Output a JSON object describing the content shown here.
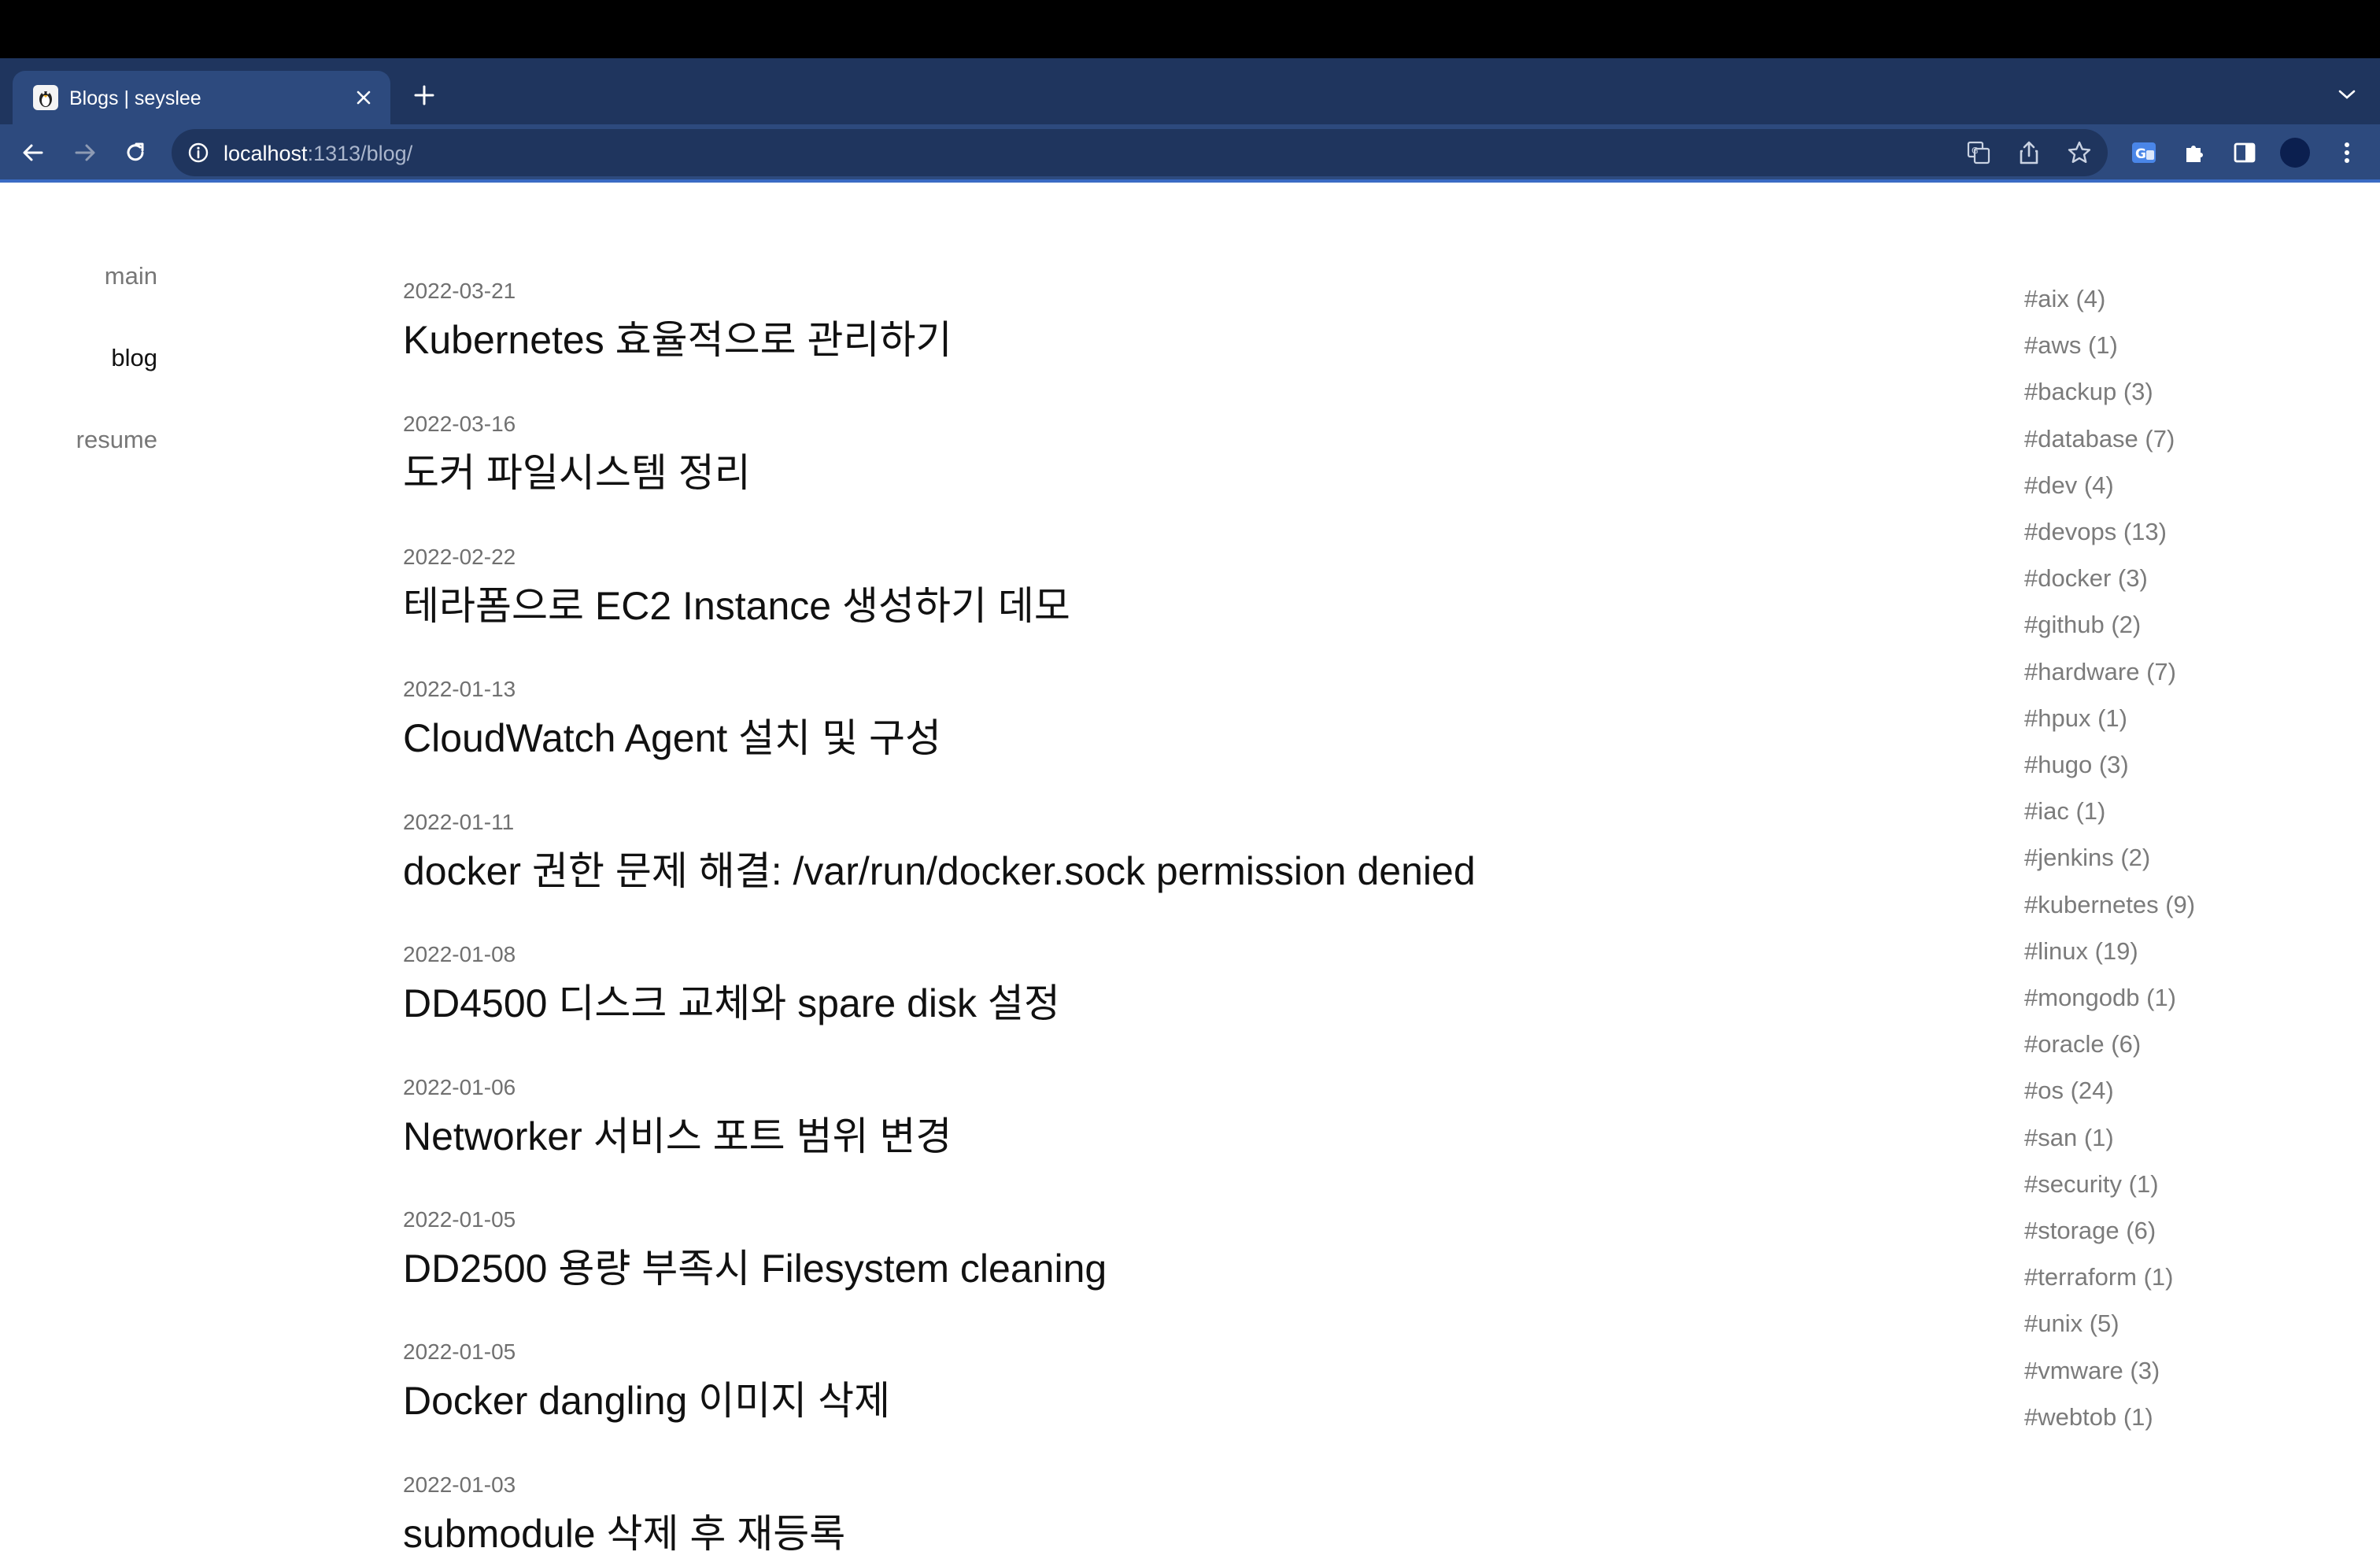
{
  "browser": {
    "tab_title": "Blogs | seyslee",
    "url_host": "localhost",
    "url_path": ":1313/blog/"
  },
  "nav": {
    "items": [
      {
        "label": "main",
        "active": false
      },
      {
        "label": "blog",
        "active": true
      },
      {
        "label": "resume",
        "active": false
      }
    ]
  },
  "posts": [
    {
      "date": "2022-03-21",
      "title": "Kubernetes 효율적으로 관리하기"
    },
    {
      "date": "2022-03-16",
      "title": "도커 파일시스템 정리"
    },
    {
      "date": "2022-02-22",
      "title": "테라폼으로 EC2 Instance 생성하기 데모"
    },
    {
      "date": "2022-01-13",
      "title": "CloudWatch Agent 설치 및 구성"
    },
    {
      "date": "2022-01-11",
      "title": "docker 권한 문제 해결: /var/run/docker.sock permission denied"
    },
    {
      "date": "2022-01-08",
      "title": "DD4500 디스크 교체와 spare disk 설정"
    },
    {
      "date": "2022-01-06",
      "title": "Networker 서비스 포트 범위 변경"
    },
    {
      "date": "2022-01-05",
      "title": "DD2500 용량 부족시 Filesystem cleaning"
    },
    {
      "date": "2022-01-05",
      "title": "Docker dangling 이미지 삭제"
    },
    {
      "date": "2022-01-03",
      "title": "submodule 삭제 후 재등록"
    }
  ],
  "tags": [
    "#aix (4)",
    "#aws (1)",
    "#backup (3)",
    "#database (7)",
    "#dev (4)",
    "#devops (13)",
    "#docker (3)",
    "#github (2)",
    "#hardware (7)",
    "#hpux (1)",
    "#hugo (3)",
    "#iac (1)",
    "#jenkins (2)",
    "#kubernetes (9)",
    "#linux (19)",
    "#mongodb (1)",
    "#oracle (6)",
    "#os (24)",
    "#san (1)",
    "#security (1)",
    "#storage (6)",
    "#terraform (1)",
    "#unix (5)",
    "#vmware (3)",
    "#webtob (1)"
  ]
}
